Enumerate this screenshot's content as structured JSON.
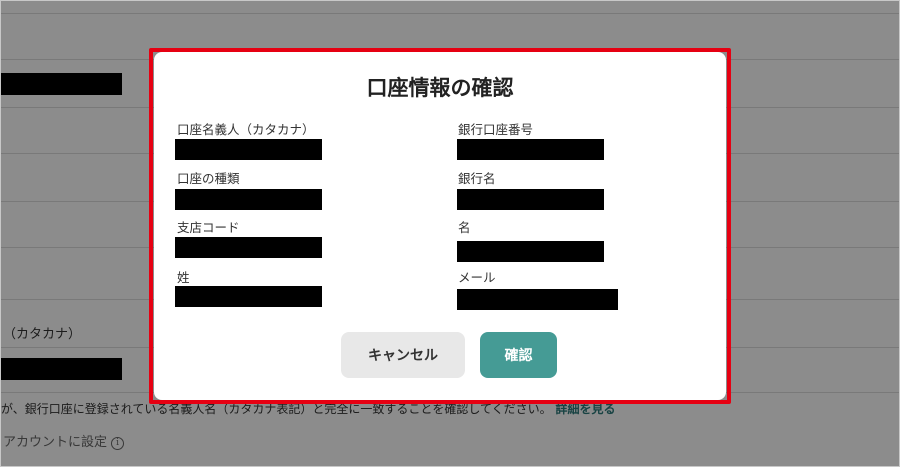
{
  "background": {
    "kana_label": "（カタカナ）",
    "notice_text": "が、銀行口座に登録されている名義人名（カタカナ表記）と完全に一致することを確認してください。",
    "notice_link": "詳細を見る",
    "default_account_label": "アカウントに設定",
    "info_icon_glyph": "i"
  },
  "dialog": {
    "title": "口座情報の確認",
    "fields": [
      {
        "label": "口座名義人（カタカナ）",
        "value": ""
      },
      {
        "label": "口座の種類",
        "value": ""
      },
      {
        "label": "支店コード",
        "value": ""
      },
      {
        "label": "姓",
        "value": ""
      },
      {
        "label": "銀行口座番号",
        "value": ""
      },
      {
        "label": "銀行名",
        "value": ""
      },
      {
        "label": "名",
        "value": ""
      },
      {
        "label": "メール",
        "value": ""
      }
    ],
    "cancel_label": "キャンセル",
    "confirm_label": "確認"
  },
  "colors": {
    "highlight": "#e60012",
    "confirm_button": "#459b95",
    "cancel_button": "#e8e8e8",
    "overlay": "rgba(0,0,0,0.45)",
    "redaction": "#000000"
  }
}
